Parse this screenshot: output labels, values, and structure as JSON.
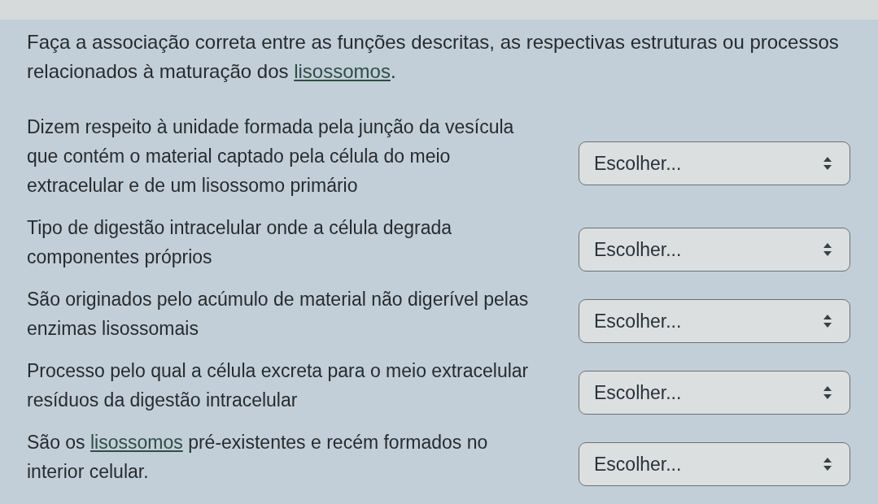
{
  "question": {
    "parts": [
      {
        "kind": "text",
        "text": "Faça a associação correta entre as funções descritas, as respectivas estruturas ou processos relacionados à maturação dos "
      },
      {
        "kind": "link",
        "text": "lisossomos"
      },
      {
        "kind": "text",
        "text": "."
      }
    ]
  },
  "items": [
    {
      "parts": [
        {
          "kind": "text",
          "text": "Dizem respeito à unidade formada pela junção da vesícula que contém o material captado pela célula do meio extracelular e de um lisossomo primário"
        }
      ],
      "choice": {
        "value": "Escolher..."
      }
    },
    {
      "parts": [
        {
          "kind": "text",
          "text": "Tipo de digestão intracelular onde a célula degrada componentes próprios"
        }
      ],
      "choice": {
        "value": "Escolher..."
      }
    },
    {
      "parts": [
        {
          "kind": "text",
          "text": "São originados pelo acúmulo de material não digerível pelas enzimas lisossomais"
        }
      ],
      "choice": {
        "value": "Escolher..."
      }
    },
    {
      "parts": [
        {
          "kind": "text",
          "text": "Processo pelo qual a célula excreta para o meio extracelular resíduos da digestão intracelular"
        }
      ],
      "choice": {
        "value": "Escolher..."
      }
    },
    {
      "parts": [
        {
          "kind": "text",
          "text": "São os "
        },
        {
          "kind": "link",
          "text": "lisossomos"
        },
        {
          "kind": "text",
          "text": " pré-existentes e recém formados no interior celular."
        }
      ],
      "choice": {
        "value": "Escolher..."
      }
    }
  ]
}
